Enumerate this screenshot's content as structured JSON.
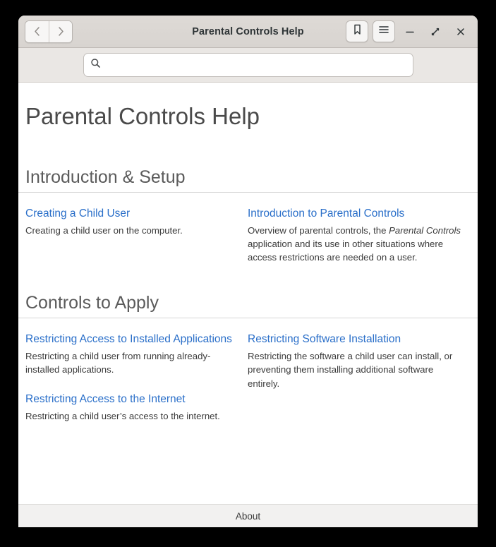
{
  "window": {
    "title": "Parental Controls Help"
  },
  "headerbar": {
    "back_icon": "chevron-left-icon",
    "forward_icon": "chevron-right-icon",
    "bookmark_icon": "bookmark-icon",
    "menu_icon": "hamburger-menu-icon",
    "minimize_icon": "minimize-icon",
    "maximize_icon": "maximize-icon",
    "close_icon": "close-icon"
  },
  "search": {
    "icon": "search-icon",
    "value": "",
    "placeholder": ""
  },
  "page": {
    "title": "Parental Controls Help"
  },
  "sections": [
    {
      "heading": "Introduction & Setup",
      "left": [
        {
          "link": "Creating a Child User",
          "desc_before": "Creating a child user on the computer.",
          "desc_italic": "",
          "desc_after": ""
        }
      ],
      "right": [
        {
          "link": "Introduction to Parental Controls",
          "desc_before": "Overview of parental controls, the ",
          "desc_italic": "Parental Controls",
          "desc_after": " application and its use in other situations where access restrictions are needed on a user."
        }
      ]
    },
    {
      "heading": "Controls to Apply",
      "left": [
        {
          "link": "Restricting Access to Installed Applications",
          "desc_before": "Restricting a child user from running already-installed applications.",
          "desc_italic": "",
          "desc_after": ""
        },
        {
          "link": "Restricting Access to the Internet",
          "desc_before": "Restricting a child user’s access to the internet.",
          "desc_italic": "",
          "desc_after": ""
        }
      ],
      "right": [
        {
          "link": "Restricting Software Installation",
          "desc_before": "Restricting the software a child user can install, or preventing them installing additional software entirely.",
          "desc_italic": "",
          "desc_after": ""
        }
      ]
    }
  ],
  "footer": {
    "about_label": "About"
  },
  "colors": {
    "link": "#2a6fc9",
    "headerbar": "#dedad6",
    "content_bg": "#ffffff",
    "footer_bg": "#f2f1f0"
  }
}
